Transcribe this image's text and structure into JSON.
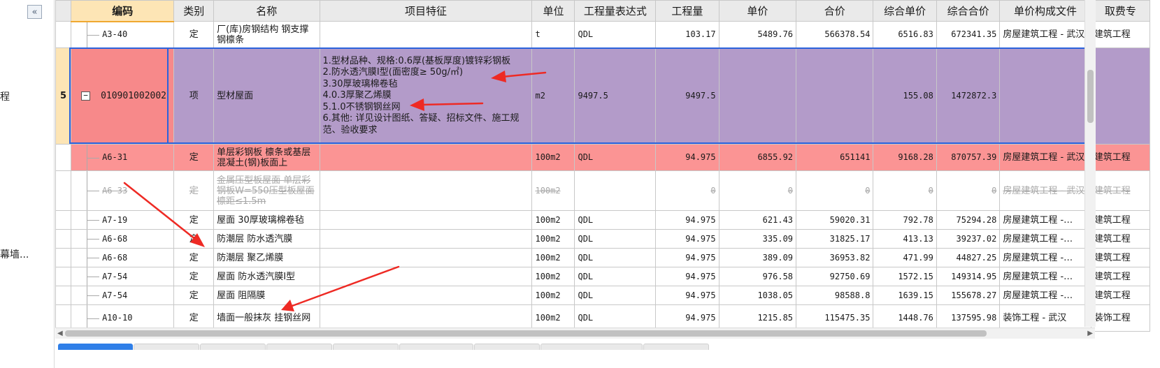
{
  "sidebar": {
    "collapse_label": "«",
    "items": [
      "程",
      "幕墙..."
    ]
  },
  "columns": [
    "编码",
    "类别",
    "名称",
    "项目特征",
    "单位",
    "工程量表达式",
    "工程量",
    "单价",
    "合价",
    "综合单价",
    "综合合价",
    "单价构成文件",
    "取费专"
  ],
  "rows": [
    {
      "num": "",
      "code": "A3-40",
      "type": "定",
      "name": "厂(库)房钢结构 钢支撑钢檩条",
      "feature": "",
      "unit": "t",
      "expr": "QDL",
      "qty": "103.17",
      "price": "5489.76",
      "total": "566378.54",
      "cprice": "6516.83",
      "ctotal": "672341.35",
      "file": "房屋建筑工程 - 武汉",
      "fee": "建筑工程"
    },
    {
      "num": "5",
      "code": "010901002002",
      "type": "项",
      "name": "型材屋面",
      "feature": [
        "1.型材品种、规格:0.6厚(基板厚度)镀锌彩钢板",
        "2.防水透汽膜I型(面密度≥ 50g/㎡)",
        "3.30厚玻璃棉卷毡",
        "4.0.3厚聚乙烯膜",
        "5.1.0不锈钢钢丝网",
        "6.其他: 详见设计图纸、答疑、招标文件、施工规范、验收要求"
      ],
      "unit": "m2",
      "expr": "9497.5",
      "qty": "9497.5",
      "price": "",
      "total": "",
      "cprice": "155.08",
      "ctotal": "1472872.3",
      "file": "",
      "fee": ""
    },
    {
      "num": "",
      "code": "A6-31",
      "type": "定",
      "name": "单层彩钢板 檩条或基层混凝土(钢)板面上",
      "feature": "",
      "unit": "100m2",
      "expr": "QDL",
      "qty": "94.975",
      "price": "6855.92",
      "total": "651141",
      "cprice": "9168.28",
      "ctotal": "870757.39",
      "file": "房屋建筑工程 - 武汉",
      "fee": "建筑工程"
    },
    {
      "num": "",
      "code": "A6-33",
      "type": "定",
      "name": "金属压型板屋面 单层彩钢板W=550压型板屋面 檩距≤1.5m",
      "feature": "",
      "unit": "100m2",
      "expr": "",
      "qty": "0",
      "price": "0",
      "total": "0",
      "cprice": "0",
      "ctotal": "0",
      "file": "房屋建筑工程 - 武汉",
      "fee": "建筑工程"
    },
    {
      "num": "",
      "code": "A7-19",
      "type": "定",
      "name": "屋面 30厚玻璃棉卷毡",
      "feature": "",
      "unit": "100m2",
      "expr": "QDL",
      "qty": "94.975",
      "price": "621.43",
      "total": "59020.31",
      "cprice": "792.78",
      "ctotal": "75294.28",
      "file": "房屋建筑工程 -…",
      "fee": "建筑工程"
    },
    {
      "num": "",
      "code": "A6-68",
      "type": "定",
      "name": "防潮层 防水透汽膜",
      "feature": "",
      "unit": "100m2",
      "expr": "QDL",
      "qty": "94.975",
      "price": "335.09",
      "total": "31825.17",
      "cprice": "413.13",
      "ctotal": "39237.02",
      "file": "房屋建筑工程 -…",
      "fee": "建筑工程"
    },
    {
      "num": "",
      "code": "A6-68",
      "type": "定",
      "name": "防潮层 聚乙烯膜",
      "feature": "",
      "unit": "100m2",
      "expr": "QDL",
      "qty": "94.975",
      "price": "389.09",
      "total": "36953.82",
      "cprice": "471.99",
      "ctotal": "44827.25",
      "file": "房屋建筑工程 -…",
      "fee": "建筑工程"
    },
    {
      "num": "",
      "code": "A7-54",
      "type": "定",
      "name": "屋面 防水透汽膜I型",
      "feature": "",
      "unit": "100m2",
      "expr": "QDL",
      "qty": "94.975",
      "price": "976.58",
      "total": "92750.69",
      "cprice": "1572.15",
      "ctotal": "149314.95",
      "file": "房屋建筑工程 -…",
      "fee": "建筑工程"
    },
    {
      "num": "",
      "code": "A7-54",
      "type": "定",
      "name": "屋面 阻隔膜",
      "feature": "",
      "unit": "100m2",
      "expr": "QDL",
      "qty": "94.975",
      "price": "1038.05",
      "total": "98588.8",
      "cprice": "1639.15",
      "ctotal": "155678.27",
      "file": "房屋建筑工程 -…",
      "fee": "建筑工程"
    },
    {
      "num": "",
      "code": "A10-10",
      "type": "定",
      "name": "墙面一般抹灰 挂钢丝网",
      "feature": "",
      "unit": "100m2",
      "expr": "QDL",
      "qty": "94.975",
      "price": "1215.85",
      "total": "115475.35",
      "cprice": "1448.76",
      "ctotal": "137595.98",
      "file": "装饰工程 - 武汉",
      "fee": "装饰工程"
    }
  ],
  "colors": {
    "bill_row": "#b39bc9",
    "bill_code": "#f7898a",
    "selected_quota": "#fb9494",
    "selection_border": "#2b62dc",
    "annotation_arrow": "#ee2a24"
  }
}
